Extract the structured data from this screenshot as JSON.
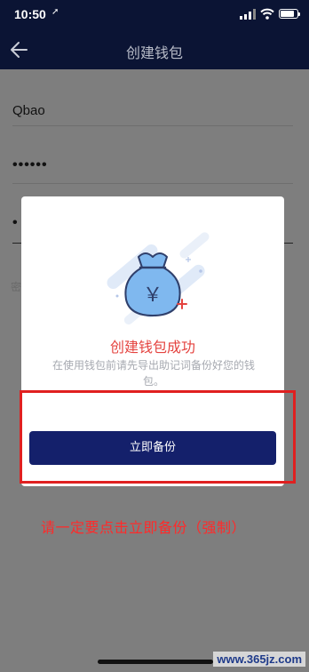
{
  "status_bar": {
    "time": "10:50",
    "location_icon": "➚"
  },
  "nav": {
    "title": "创建钱包",
    "back_icon": "arrow-left"
  },
  "form": {
    "wallet_name": "Qbao",
    "password_masked": "••••••",
    "confirm_password_masked": "•",
    "hint_fragment": "密"
  },
  "modal": {
    "title": "创建钱包成功",
    "description": "在使用钱包前请先导出助记词备份好您的钱包。",
    "backup_button": "立即备份",
    "money_bag_symbol": "￥"
  },
  "annotation": {
    "text": "请一定要点击立即备份（强制）"
  },
  "watermark": "www.365jz.com",
  "colors": {
    "nav_bg": "#0b1434",
    "accent": "#14206b",
    "highlight": "#e02020",
    "success_text": "#e4433f"
  }
}
